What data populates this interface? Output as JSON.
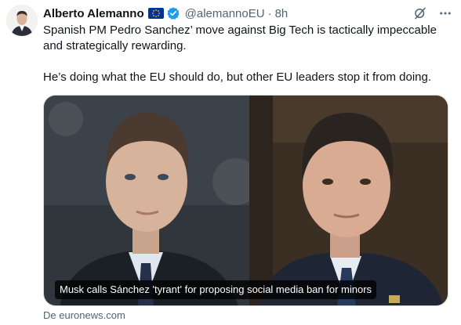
{
  "author": {
    "name": "Alberto Alemanno",
    "handle": "@alemannoEU",
    "separator": "·",
    "time": "8h"
  },
  "icons": {
    "flag": "eu-flag-icon",
    "verified": "verified-badge-icon",
    "grok": "grok-icon",
    "more": "more-icon"
  },
  "tweet": {
    "paragraph1": "Spanish PM Pedro Sanchez’ move against Big Tech is tactically impeccable and strategically rewarding.",
    "paragraph2": "He’s doing what the EU should do, but other EU leaders stop it from doing."
  },
  "card": {
    "caption": "Musk calls Sánchez 'tyrant' for proposing social media ban for minors",
    "source": "De euronews.com"
  },
  "colors": {
    "text": "#0f1419",
    "secondary": "#536471",
    "verified": "#1d9bf0",
    "eu_blue": "#003399",
    "eu_gold": "#ffcc00"
  }
}
